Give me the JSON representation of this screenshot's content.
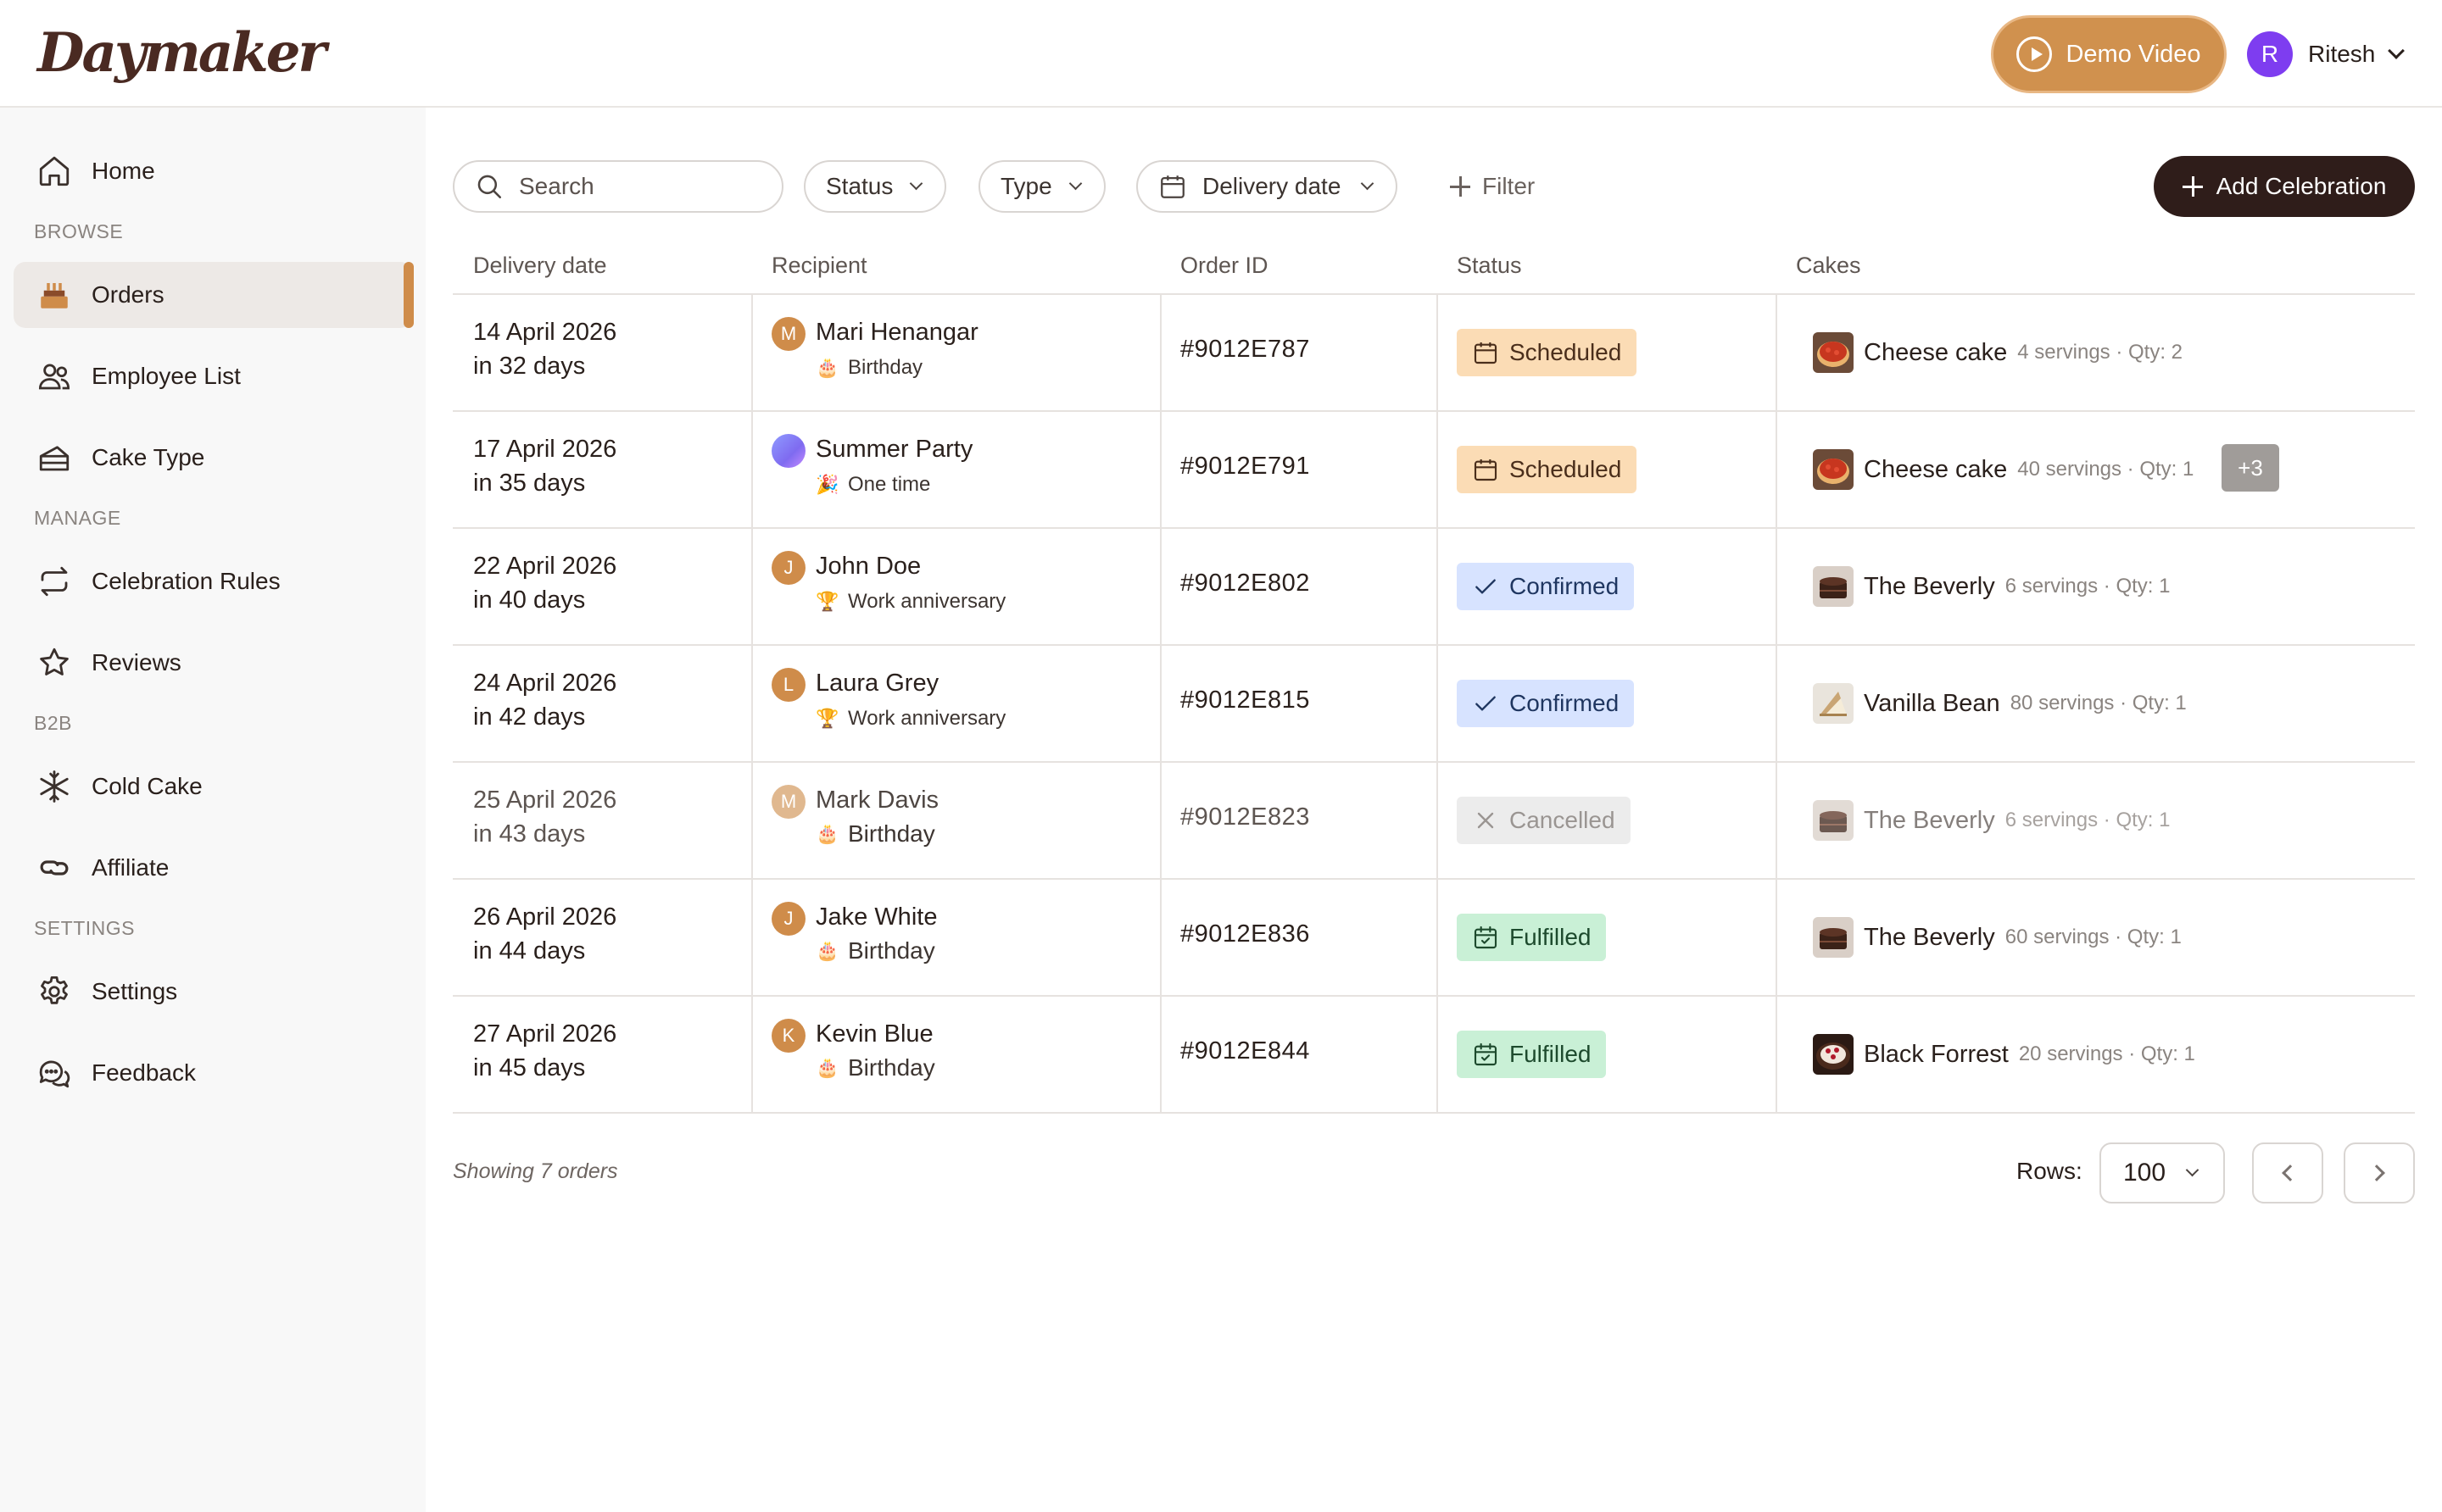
{
  "app": {
    "logo_text": "Daymaker",
    "demo_button": "Demo Video",
    "user": {
      "initial": "R",
      "name": "Ritesh"
    }
  },
  "sidebar": {
    "home": "Home",
    "sections": {
      "browse": "BROWSE",
      "manage": "MANAGE",
      "b2b": "B2B",
      "settings": "SETTINGS"
    },
    "items": {
      "orders": "Orders",
      "employee_list": "Employee List",
      "cake_type": "Cake Type",
      "celebration_rules": "Celebration Rules",
      "reviews": "Reviews",
      "cold_cake": "Cold Cake",
      "affiliate": "Affiliate",
      "settings": "Settings",
      "feedback": "Feedback"
    },
    "active": "orders"
  },
  "toolbar": {
    "search_placeholder": "Search",
    "status_filter": "Status",
    "type_filter": "Type",
    "delivery_date_filter": "Delivery date",
    "filter_button": "Filter",
    "add_button": "Add Celebration"
  },
  "table": {
    "columns": [
      "Delivery date",
      "Recipient",
      "Order ID",
      "Status",
      "Cakes"
    ],
    "rows": [
      {
        "date": "14 April 2026",
        "relative": "in 32 days",
        "initial": "M",
        "recipient": "Mari Henangar",
        "occasion": "Birthday",
        "occasion_icon": "🎂",
        "order_id": "#9012E787",
        "status": "Scheduled",
        "cake": "Cheese cake",
        "cake_meta": "4 servings · Qty: 2"
      },
      {
        "date": "17 April 2026",
        "relative": "in 35 days",
        "initial": "",
        "recipient": "Summer Party",
        "occasion": "One time",
        "occasion_icon": "🎉",
        "order_id": "#9012E791",
        "status": "Scheduled",
        "cake": "Cheese cake",
        "cake_meta": "40 servings · Qty: 1",
        "more": "+3"
      },
      {
        "date": "22 April 2026",
        "relative": "in 40 days",
        "initial": "J",
        "recipient": "John Doe",
        "occasion": "Work anniversary",
        "occasion_icon": "🏆",
        "order_id": "#9012E802",
        "status": "Confirmed",
        "cake": "The Beverly",
        "cake_meta": "6 servings · Qty: 1"
      },
      {
        "date": "24 April 2026",
        "relative": "in 42 days",
        "initial": "L",
        "recipient": "Laura Grey",
        "occasion": "Work anniversary",
        "occasion_icon": "🏆",
        "order_id": "#9012E815",
        "status": "Confirmed",
        "cake": "Vanilla Bean",
        "cake_meta": "80 servings · Qty: 1"
      },
      {
        "date": "25 April 2026",
        "relative": "in 43 days",
        "initial": "M",
        "recipient": "Mark Davis",
        "occasion": "Birthday",
        "occasion_icon": "🎂",
        "order_id": "#9012E823",
        "status": "Cancelled",
        "cake": "The Beverly",
        "cake_meta": "6 servings · Qty: 1"
      },
      {
        "date": "26 April 2026",
        "relative": "in 44 days",
        "initial": "J",
        "recipient": "Jake White",
        "occasion": "Birthday",
        "occasion_icon": "🎂",
        "order_id": "#9012E836",
        "status": "Fulfilled",
        "cake": "The Beverly",
        "cake_meta": "60 servings · Qty: 1"
      },
      {
        "date": "27 April 2026",
        "relative": "in 45 days",
        "initial": "K",
        "recipient": "Kevin Blue",
        "occasion": "Birthday",
        "occasion_icon": "🎂",
        "order_id": "#9012E844",
        "status": "Fulfilled",
        "cake": "Black Forrest",
        "cake_meta": "20 servings · Qty: 1"
      }
    ]
  },
  "footer": {
    "showing": "Showing 7 orders",
    "rows_label": "Rows:",
    "rows_value": "100"
  },
  "colors": {
    "accent": "#d0914e",
    "dark": "#2f1d1a",
    "scheduled_bg": "#fbdcb5",
    "confirmed_bg": "#d7e3ff",
    "cancelled_bg": "#ececec",
    "fulfilled_bg": "#c9f0d6"
  }
}
